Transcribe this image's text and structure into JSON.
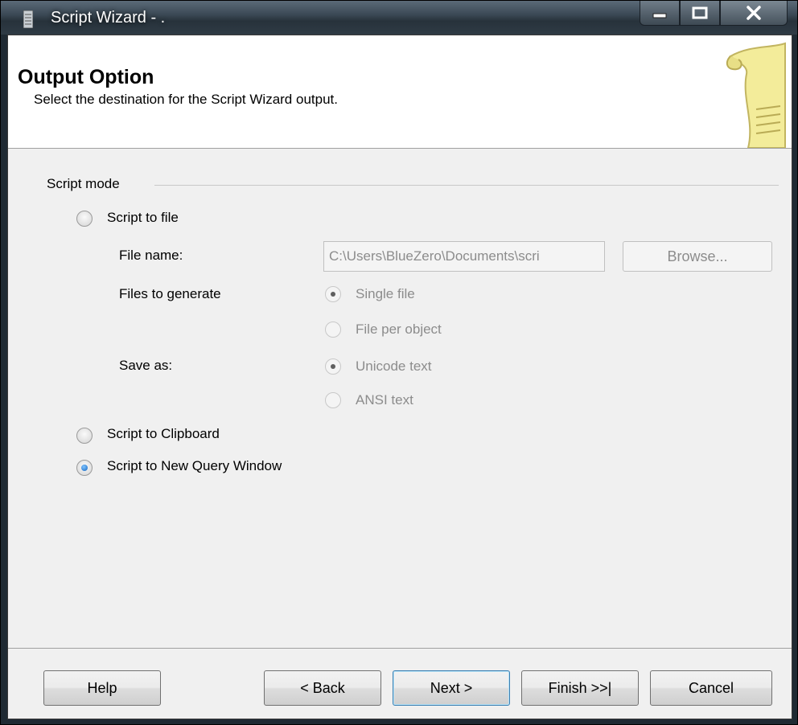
{
  "window": {
    "title": "Script Wizard - ."
  },
  "header": {
    "title": "Output Option",
    "subtitle": "Select the destination for the Script Wizard output."
  },
  "script_mode": {
    "group_label": "Script mode",
    "options": {
      "to_file": {
        "label": "Script to file",
        "checked": false
      },
      "to_clipboard": {
        "label": "Script to Clipboard",
        "checked": false
      },
      "to_query_window": {
        "label": "Script to New Query Window",
        "checked": true
      }
    },
    "file_name": {
      "label": "File name:",
      "value": "C:\\Users\\BlueZero\\Documents\\scri",
      "browse_label": "Browse..."
    },
    "files_to_generate": {
      "label": "Files to generate",
      "single_file": "Single file",
      "file_per_object": "File per object",
      "selected": "Single file"
    },
    "save_as": {
      "label": "Save as:",
      "unicode": "Unicode text",
      "ansi": "ANSI text",
      "selected": "Unicode text"
    }
  },
  "footer": {
    "help": "Help",
    "back": "< Back",
    "next": "Next >",
    "finish": "Finish >>|",
    "cancel": "Cancel"
  },
  "icons": [
    "window-icon",
    "minimize-icon",
    "maximize-icon",
    "close-icon",
    "script-scroll-icon"
  ],
  "colors": {
    "selected_radio": "#1565c0",
    "titlebar": "#2f3b45"
  }
}
